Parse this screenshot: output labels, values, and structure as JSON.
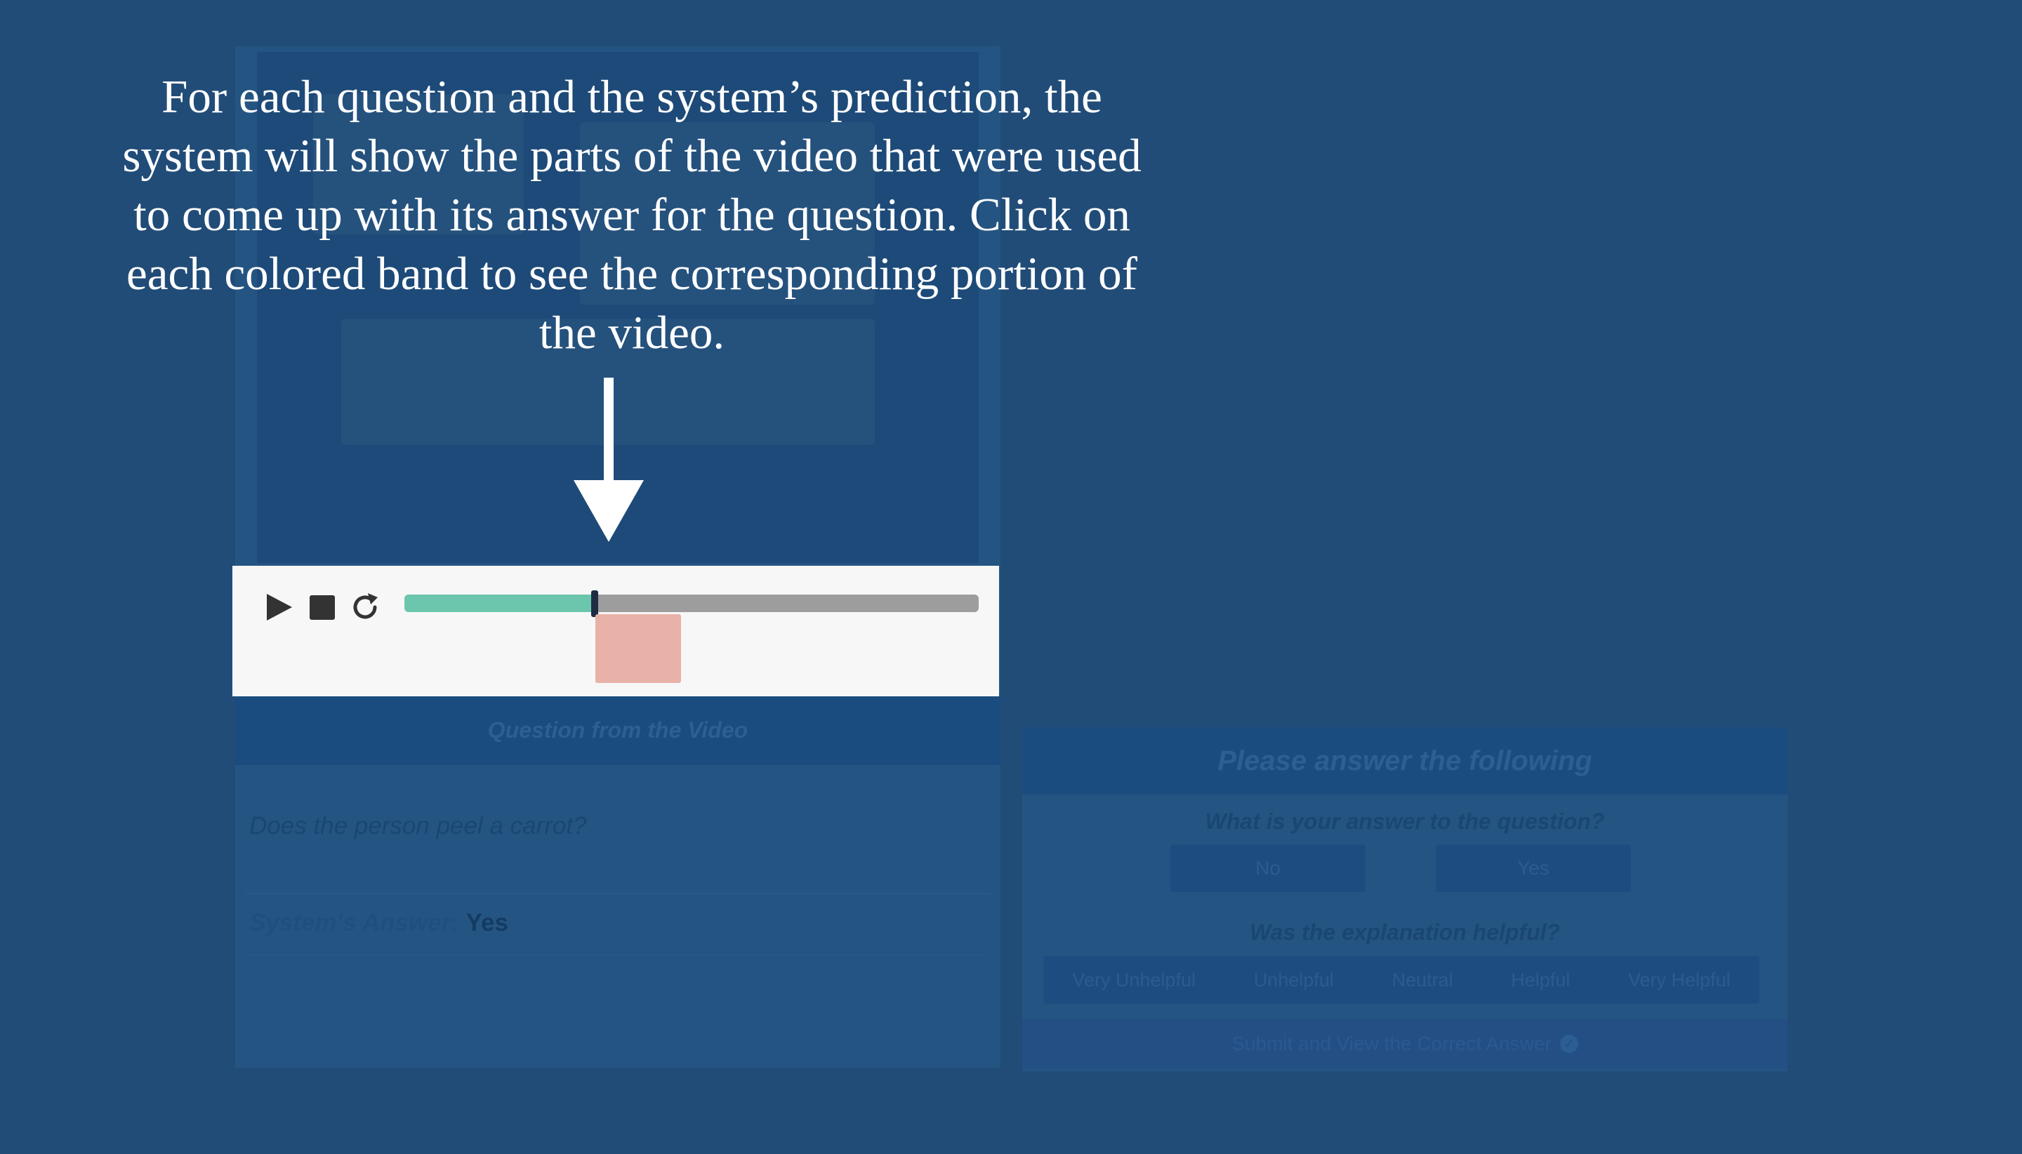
{
  "instruction": {
    "text": "For each question and the system’s prediction, the system will show the parts of the video that were used to come up with its answer for the question. Click on each colored band to see the corresponding portion of the video."
  },
  "player": {
    "play_icon": "play-icon",
    "stop_icon": "stop-icon",
    "replay_icon": "replay-icon",
    "progress": 0.33,
    "progress_color": "#6cc6ae",
    "band_color": "#e8b2a8"
  },
  "question_panel": {
    "header": "Question from the Video",
    "question": "Does the person peel a carrot?",
    "system_answer_label": "System's Answer:",
    "system_answer_value": "Yes"
  },
  "answer_panel": {
    "header": "Please answer the following",
    "answer_question": "What is your answer to the question?",
    "options": [
      "No",
      "Yes"
    ],
    "helpful_question": "Was the explanation helpful?",
    "ratings": [
      "Very Unhelpful",
      "Unhelpful",
      "Neutral",
      "Helpful",
      "Very Helpful"
    ],
    "submit": "Submit and View the Correct Answer"
  },
  "colors": {
    "overlay": "#214c78",
    "player_background": "#f7f7f7"
  }
}
